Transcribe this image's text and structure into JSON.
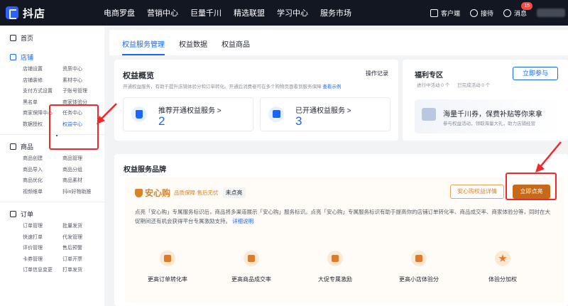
{
  "topbar": {
    "logo_text": "抖店",
    "nav": [
      "电商罗盘",
      "营销中心",
      "巨量千川",
      "精选联盟",
      "学习中心",
      "服务市场"
    ],
    "client_label": "客户端",
    "service_label": "接待",
    "message_label": "消息",
    "message_badge": "15"
  },
  "sidebar": {
    "home": "首页",
    "sections": [
      {
        "title": "店铺",
        "items": [
          "店铺设置",
          "资质中心",
          "店铺装修",
          "素材中心",
          "支付方式设置",
          "子账号管理",
          "黑名单",
          "商家体验分",
          "商家保障中心",
          "任务中心",
          "数据授权",
          "权益中心"
        ]
      },
      {
        "title": "商品",
        "items": [
          "商品创建",
          "商品管理",
          "商品导入",
          "商品分组",
          "商品优化",
          "商品素材",
          "视频维单",
          "抖in好物助推"
        ]
      },
      {
        "title": "订单",
        "items": [
          "订单管理",
          "批量发货",
          "快速打单",
          "代发管理",
          "评价管理",
          "售后预警",
          "卡券管理",
          "订单开票",
          "订单信息变更",
          "打单发货"
        ]
      }
    ]
  },
  "tabs": [
    "权益服务管理",
    "权益数据",
    "权益商品"
  ],
  "overview": {
    "title": "权益概览",
    "log_label": "操作记录",
    "description": "开通权益服务，有助于提升店铺体验分和订单转化。开通后消费者可在多个购物页面看到服务保障",
    "example_link": "查看示例",
    "recommend_label": "推荐开通权益服务 >",
    "recommend_count": "2",
    "opened_label": "已开通权益服务 >",
    "opened_count": "3"
  },
  "benefit": {
    "title": "福利专区",
    "join_label": "立即参与",
    "in_progress": "进行中活动 0 个",
    "joined": "已完成活动 0 个",
    "main_text": "海量千川券，保费补贴等你来拿",
    "note": "参与权益活动，领取海量大礼，助力店铺经营"
  },
  "brand": {
    "title": "权益服务品牌",
    "anxin_name": "安心购",
    "anxin_tag": "品质保障·售后无忧",
    "status": "未点亮",
    "detail_label": "安心购权益详情",
    "light_label": "立即点亮",
    "description": "点亮「安心购」专属服务标识后，商品将多渠道展示「安心购」服务标识。点亮「安心购」专属服务标识有助于提高你的店铺订单转化率、商品成交率、商家体验分等，同时在大促期间还有机会获得平台专属激励支持。",
    "detail_link": "详细说明",
    "features": [
      "更高订单转化率",
      "更高商品成交率",
      "大促专属激励",
      "更高小店体验分",
      "体验分加权"
    ]
  },
  "colors": {
    "accent": "#1966ff",
    "annotation": "#f2272a",
    "brand_orange": "#d9822b"
  }
}
